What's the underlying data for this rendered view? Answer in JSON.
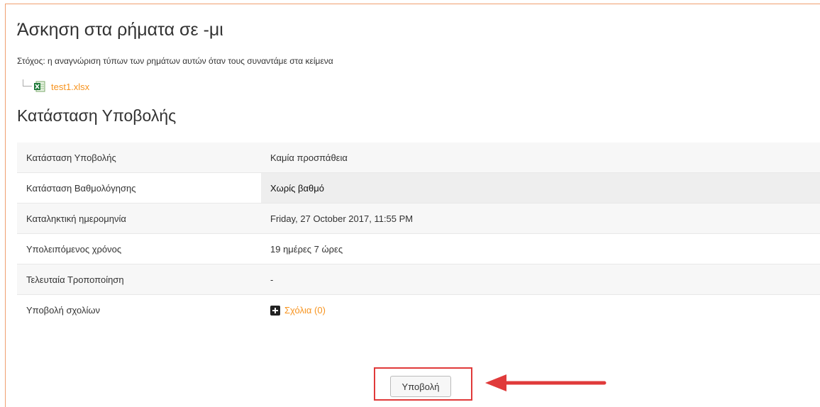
{
  "page": {
    "title": "Άσκηση στα ρήματα σε -μι",
    "description": "Στόχος: η αναγνώριση τύπων των ρημάτων αυτών όταν τους συναντάμε στα κείμενα",
    "attachment": {
      "name": "test1.xlsx",
      "icon": "excel-file-icon"
    },
    "accent_color": "#f7931e"
  },
  "submission_status": {
    "heading": "Κατάσταση Υποβολής",
    "rows": [
      {
        "label": "Κατάσταση Υποβολής",
        "value": "Καμία προσπάθεια"
      },
      {
        "label": "Κατάσταση Βαθμολόγησης",
        "value": "Χωρίς βαθμό"
      },
      {
        "label": "Καταληκτική ημερομηνία",
        "value": "Friday, 27 October 2017, 11:55 PM"
      },
      {
        "label": "Υπολειπόμενος χρόνος",
        "value": "19 ημέρες 7 ώρες"
      },
      {
        "label": "Τελευταία Τροποποίηση",
        "value": "-"
      },
      {
        "label": "Υποβολή σχολίων",
        "comments_link": "Σχόλια (0)"
      }
    ]
  },
  "actions": {
    "submit_label": "Υποβολή",
    "annotation_color": "#e03a3a"
  }
}
